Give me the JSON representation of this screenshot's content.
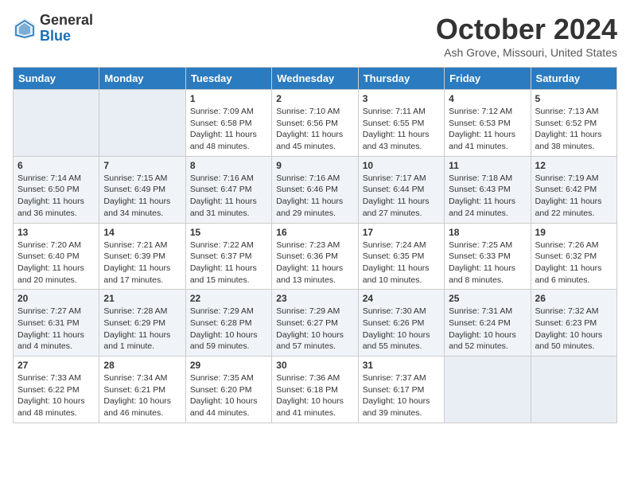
{
  "logo": {
    "general": "General",
    "blue": "Blue"
  },
  "title": "October 2024",
  "location": "Ash Grove, Missouri, United States",
  "days_of_week": [
    "Sunday",
    "Monday",
    "Tuesday",
    "Wednesday",
    "Thursday",
    "Friday",
    "Saturday"
  ],
  "weeks": [
    [
      {
        "day": "",
        "info": ""
      },
      {
        "day": "",
        "info": ""
      },
      {
        "day": "1",
        "info": "Sunrise: 7:09 AM\nSunset: 6:58 PM\nDaylight: 11 hours and 48 minutes."
      },
      {
        "day": "2",
        "info": "Sunrise: 7:10 AM\nSunset: 6:56 PM\nDaylight: 11 hours and 45 minutes."
      },
      {
        "day": "3",
        "info": "Sunrise: 7:11 AM\nSunset: 6:55 PM\nDaylight: 11 hours and 43 minutes."
      },
      {
        "day": "4",
        "info": "Sunrise: 7:12 AM\nSunset: 6:53 PM\nDaylight: 11 hours and 41 minutes."
      },
      {
        "day": "5",
        "info": "Sunrise: 7:13 AM\nSunset: 6:52 PM\nDaylight: 11 hours and 38 minutes."
      }
    ],
    [
      {
        "day": "6",
        "info": "Sunrise: 7:14 AM\nSunset: 6:50 PM\nDaylight: 11 hours and 36 minutes."
      },
      {
        "day": "7",
        "info": "Sunrise: 7:15 AM\nSunset: 6:49 PM\nDaylight: 11 hours and 34 minutes."
      },
      {
        "day": "8",
        "info": "Sunrise: 7:16 AM\nSunset: 6:47 PM\nDaylight: 11 hours and 31 minutes."
      },
      {
        "day": "9",
        "info": "Sunrise: 7:16 AM\nSunset: 6:46 PM\nDaylight: 11 hours and 29 minutes."
      },
      {
        "day": "10",
        "info": "Sunrise: 7:17 AM\nSunset: 6:44 PM\nDaylight: 11 hours and 27 minutes."
      },
      {
        "day": "11",
        "info": "Sunrise: 7:18 AM\nSunset: 6:43 PM\nDaylight: 11 hours and 24 minutes."
      },
      {
        "day": "12",
        "info": "Sunrise: 7:19 AM\nSunset: 6:42 PM\nDaylight: 11 hours and 22 minutes."
      }
    ],
    [
      {
        "day": "13",
        "info": "Sunrise: 7:20 AM\nSunset: 6:40 PM\nDaylight: 11 hours and 20 minutes."
      },
      {
        "day": "14",
        "info": "Sunrise: 7:21 AM\nSunset: 6:39 PM\nDaylight: 11 hours and 17 minutes."
      },
      {
        "day": "15",
        "info": "Sunrise: 7:22 AM\nSunset: 6:37 PM\nDaylight: 11 hours and 15 minutes."
      },
      {
        "day": "16",
        "info": "Sunrise: 7:23 AM\nSunset: 6:36 PM\nDaylight: 11 hours and 13 minutes."
      },
      {
        "day": "17",
        "info": "Sunrise: 7:24 AM\nSunset: 6:35 PM\nDaylight: 11 hours and 10 minutes."
      },
      {
        "day": "18",
        "info": "Sunrise: 7:25 AM\nSunset: 6:33 PM\nDaylight: 11 hours and 8 minutes."
      },
      {
        "day": "19",
        "info": "Sunrise: 7:26 AM\nSunset: 6:32 PM\nDaylight: 11 hours and 6 minutes."
      }
    ],
    [
      {
        "day": "20",
        "info": "Sunrise: 7:27 AM\nSunset: 6:31 PM\nDaylight: 11 hours and 4 minutes."
      },
      {
        "day": "21",
        "info": "Sunrise: 7:28 AM\nSunset: 6:29 PM\nDaylight: 11 hours and 1 minute."
      },
      {
        "day": "22",
        "info": "Sunrise: 7:29 AM\nSunset: 6:28 PM\nDaylight: 10 hours and 59 minutes."
      },
      {
        "day": "23",
        "info": "Sunrise: 7:29 AM\nSunset: 6:27 PM\nDaylight: 10 hours and 57 minutes."
      },
      {
        "day": "24",
        "info": "Sunrise: 7:30 AM\nSunset: 6:26 PM\nDaylight: 10 hours and 55 minutes."
      },
      {
        "day": "25",
        "info": "Sunrise: 7:31 AM\nSunset: 6:24 PM\nDaylight: 10 hours and 52 minutes."
      },
      {
        "day": "26",
        "info": "Sunrise: 7:32 AM\nSunset: 6:23 PM\nDaylight: 10 hours and 50 minutes."
      }
    ],
    [
      {
        "day": "27",
        "info": "Sunrise: 7:33 AM\nSunset: 6:22 PM\nDaylight: 10 hours and 48 minutes."
      },
      {
        "day": "28",
        "info": "Sunrise: 7:34 AM\nSunset: 6:21 PM\nDaylight: 10 hours and 46 minutes."
      },
      {
        "day": "29",
        "info": "Sunrise: 7:35 AM\nSunset: 6:20 PM\nDaylight: 10 hours and 44 minutes."
      },
      {
        "day": "30",
        "info": "Sunrise: 7:36 AM\nSunset: 6:18 PM\nDaylight: 10 hours and 41 minutes."
      },
      {
        "day": "31",
        "info": "Sunrise: 7:37 AM\nSunset: 6:17 PM\nDaylight: 10 hours and 39 minutes."
      },
      {
        "day": "",
        "info": ""
      },
      {
        "day": "",
        "info": ""
      }
    ]
  ]
}
